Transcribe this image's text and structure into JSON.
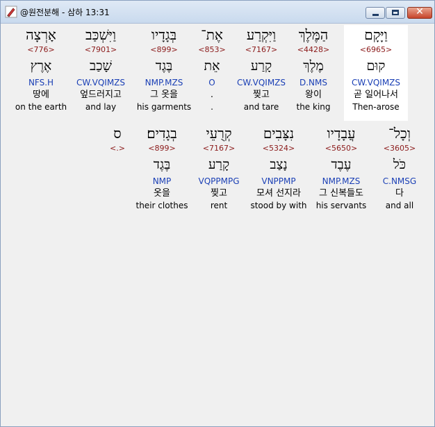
{
  "window": {
    "title": "@원전분해 - 삼하 13:31",
    "icon": "pen-icon"
  },
  "words": [
    {
      "heb": "וַיָּקָם",
      "num": "<6965>",
      "root": "קוּם",
      "parse": "CW.VQIMZS",
      "kor": "곧 일어나서",
      "eng": "Then-arose",
      "highlight": true
    },
    {
      "heb": "הַמֶּלֶךְ",
      "num": "<4428>",
      "root": "מֶלֶךְ",
      "parse": "D.NMS",
      "kor": "왕이",
      "eng": "the king",
      "highlight": false
    },
    {
      "heb": "וַיִּקְרַע",
      "num": "<7167>",
      "root": "קָרַע",
      "parse": "CW.VQIMZS",
      "kor": "찢고",
      "eng": "and tare",
      "highlight": false
    },
    {
      "heb": "אֶת־",
      "num": "<853>",
      "root": "אֵת",
      "parse": "O",
      "kor": ".",
      "eng": ".",
      "highlight": false
    },
    {
      "heb": "בְּגָדָיו",
      "num": "<899>",
      "root": "בֶּגֶד",
      "parse": "NMP.MZS",
      "kor": "그 옷을",
      "eng": "his garments",
      "highlight": false
    },
    {
      "heb": "וַיִּשְׁכַּב",
      "num": "<7901>",
      "root": "שָׁכַב",
      "parse": "CW.VQIMZS",
      "kor": "엎드러지고",
      "eng": "and lay",
      "highlight": false
    },
    {
      "heb": "אָרְצָה",
      "num": "<776>",
      "root": "אֶרֶץ",
      "parse": "NFS.H",
      "kor": "땅에",
      "eng": "on the earth",
      "highlight": false
    },
    {
      "heb": "וְכָל־",
      "num": "<3605>",
      "root": "כֹּל",
      "parse": "C.NMSG",
      "kor": "다",
      "eng": "and all",
      "highlight": false
    },
    {
      "heb": "עֲבָדָיו",
      "num": "<5650>",
      "root": "עֶבֶד",
      "parse": "NMP.MZS",
      "kor": "그 신복들도",
      "eng": "his servants",
      "highlight": false
    },
    {
      "heb": "נִצָּבִים",
      "num": "<5324>",
      "root": "נָצַב",
      "parse": "VNPPMP",
      "kor": "모셔 선지라",
      "eng": "stood by with",
      "highlight": false
    },
    {
      "heb": "קְרֻעֵי",
      "num": "<7167>",
      "root": "קָרַע",
      "parse": "VQPPMPG",
      "kor": "찢고",
      "eng": "rent",
      "highlight": false
    },
    {
      "heb": "בְגָדִים׃",
      "num": "<899>",
      "root": "בֶּגֶד",
      "parse": "NMP",
      "kor": "옷을",
      "eng": "their clothes",
      "highlight": false
    },
    {
      "heb": "ס",
      "num": "<.>",
      "root": "",
      "parse": "",
      "kor": "",
      "eng": "",
      "highlight": false
    }
  ]
}
